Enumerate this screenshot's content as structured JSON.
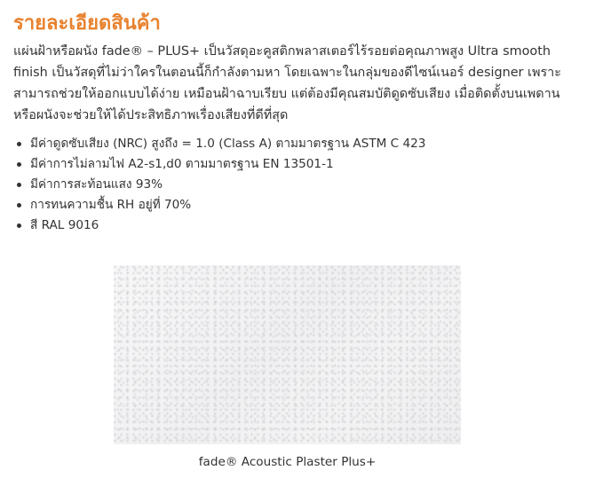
{
  "heading": "รายละเอียดสินค้า",
  "intro": "แผ่นฝ้าหรือผนัง fade® – PLUS+ เป็นวัสดุอะคูสติกพลาสเตอร์ไร้รอยต่อคุณภาพสูง Ultra smooth finish เป็นวัสดุที่ไม่ว่าใครในตอนนี้ก็กำลังตามหา โดยเฉพาะในกลุ่มของดีไซน์เนอร์ designer เพราะสามารถช่วยให้ออกแบบได้ง่าย เหมือนฝ้าฉาบเรียบ แต่ต้องมีคุณสมบัติดูดซับเสียง เมื่อติดตั้งบนเพดานหรือผนังจะช่วยให้ได้ประสิทธิภาพเรื่องเสียงที่ดีที่สุด",
  "specs": [
    "มีค่าดูดซับเสียง (NRC) สูงถึง = 1.0 (Class A) ตามมาตรฐาน ASTM C 423",
    "มีค่าการไม่ลามไฟ A2-s1,d0 ตามมาตรฐาน EN 13501-1",
    "มีค่าการสะท้อนแสง 93%",
    "การทนความชื้น RH อยู่ที่ 70%",
    "สี RAL 9016"
  ],
  "image_caption": "fade® Acoustic Plaster Plus+",
  "colors": {
    "heading": "#e8822e",
    "text": "#333333",
    "sample_surface": "#f4f4f5"
  }
}
